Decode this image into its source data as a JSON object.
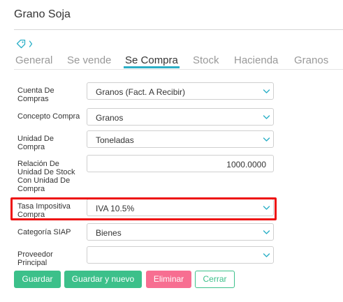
{
  "page": {
    "title": "Grano Soja"
  },
  "breadcrumb": {
    "icons": [
      "tag-icon",
      "chevron-right-icon"
    ]
  },
  "tabs": [
    {
      "label": "General",
      "active": false
    },
    {
      "label": "Se vende",
      "active": false
    },
    {
      "label": "Se Compra",
      "active": true
    },
    {
      "label": "Stock",
      "active": false
    },
    {
      "label": "Hacienda",
      "active": false
    },
    {
      "label": "Granos",
      "active": false
    }
  ],
  "form": {
    "fields": [
      {
        "label": "Cuenta De Compras",
        "value": "Granos (Fact. A Recibir)",
        "type": "select"
      },
      {
        "label": "Concepto Compra",
        "value": "Granos",
        "type": "select"
      },
      {
        "label": "Unidad De Compra",
        "value": "Toneladas",
        "type": "select"
      },
      {
        "label": "Relación De Unidad De Stock Con Unidad De Compra",
        "value": "1000.0000",
        "type": "number"
      },
      {
        "label": "Tasa Impositiva Compra",
        "value": "IVA 10.5%",
        "type": "select"
      },
      {
        "label": "Categoría SIAP",
        "value": "Bienes",
        "type": "select"
      },
      {
        "label": "Proveedor Principal",
        "value": "",
        "type": "select"
      }
    ]
  },
  "buttons": {
    "save": "Guardar",
    "save_new": "Guardar y nuevo",
    "delete": "Eliminar",
    "close": "Cerrar"
  },
  "colors": {
    "accent": "#2bafc7",
    "green": "#3cc08a",
    "danger": "#f76e91",
    "highlight": "#ee1111"
  }
}
